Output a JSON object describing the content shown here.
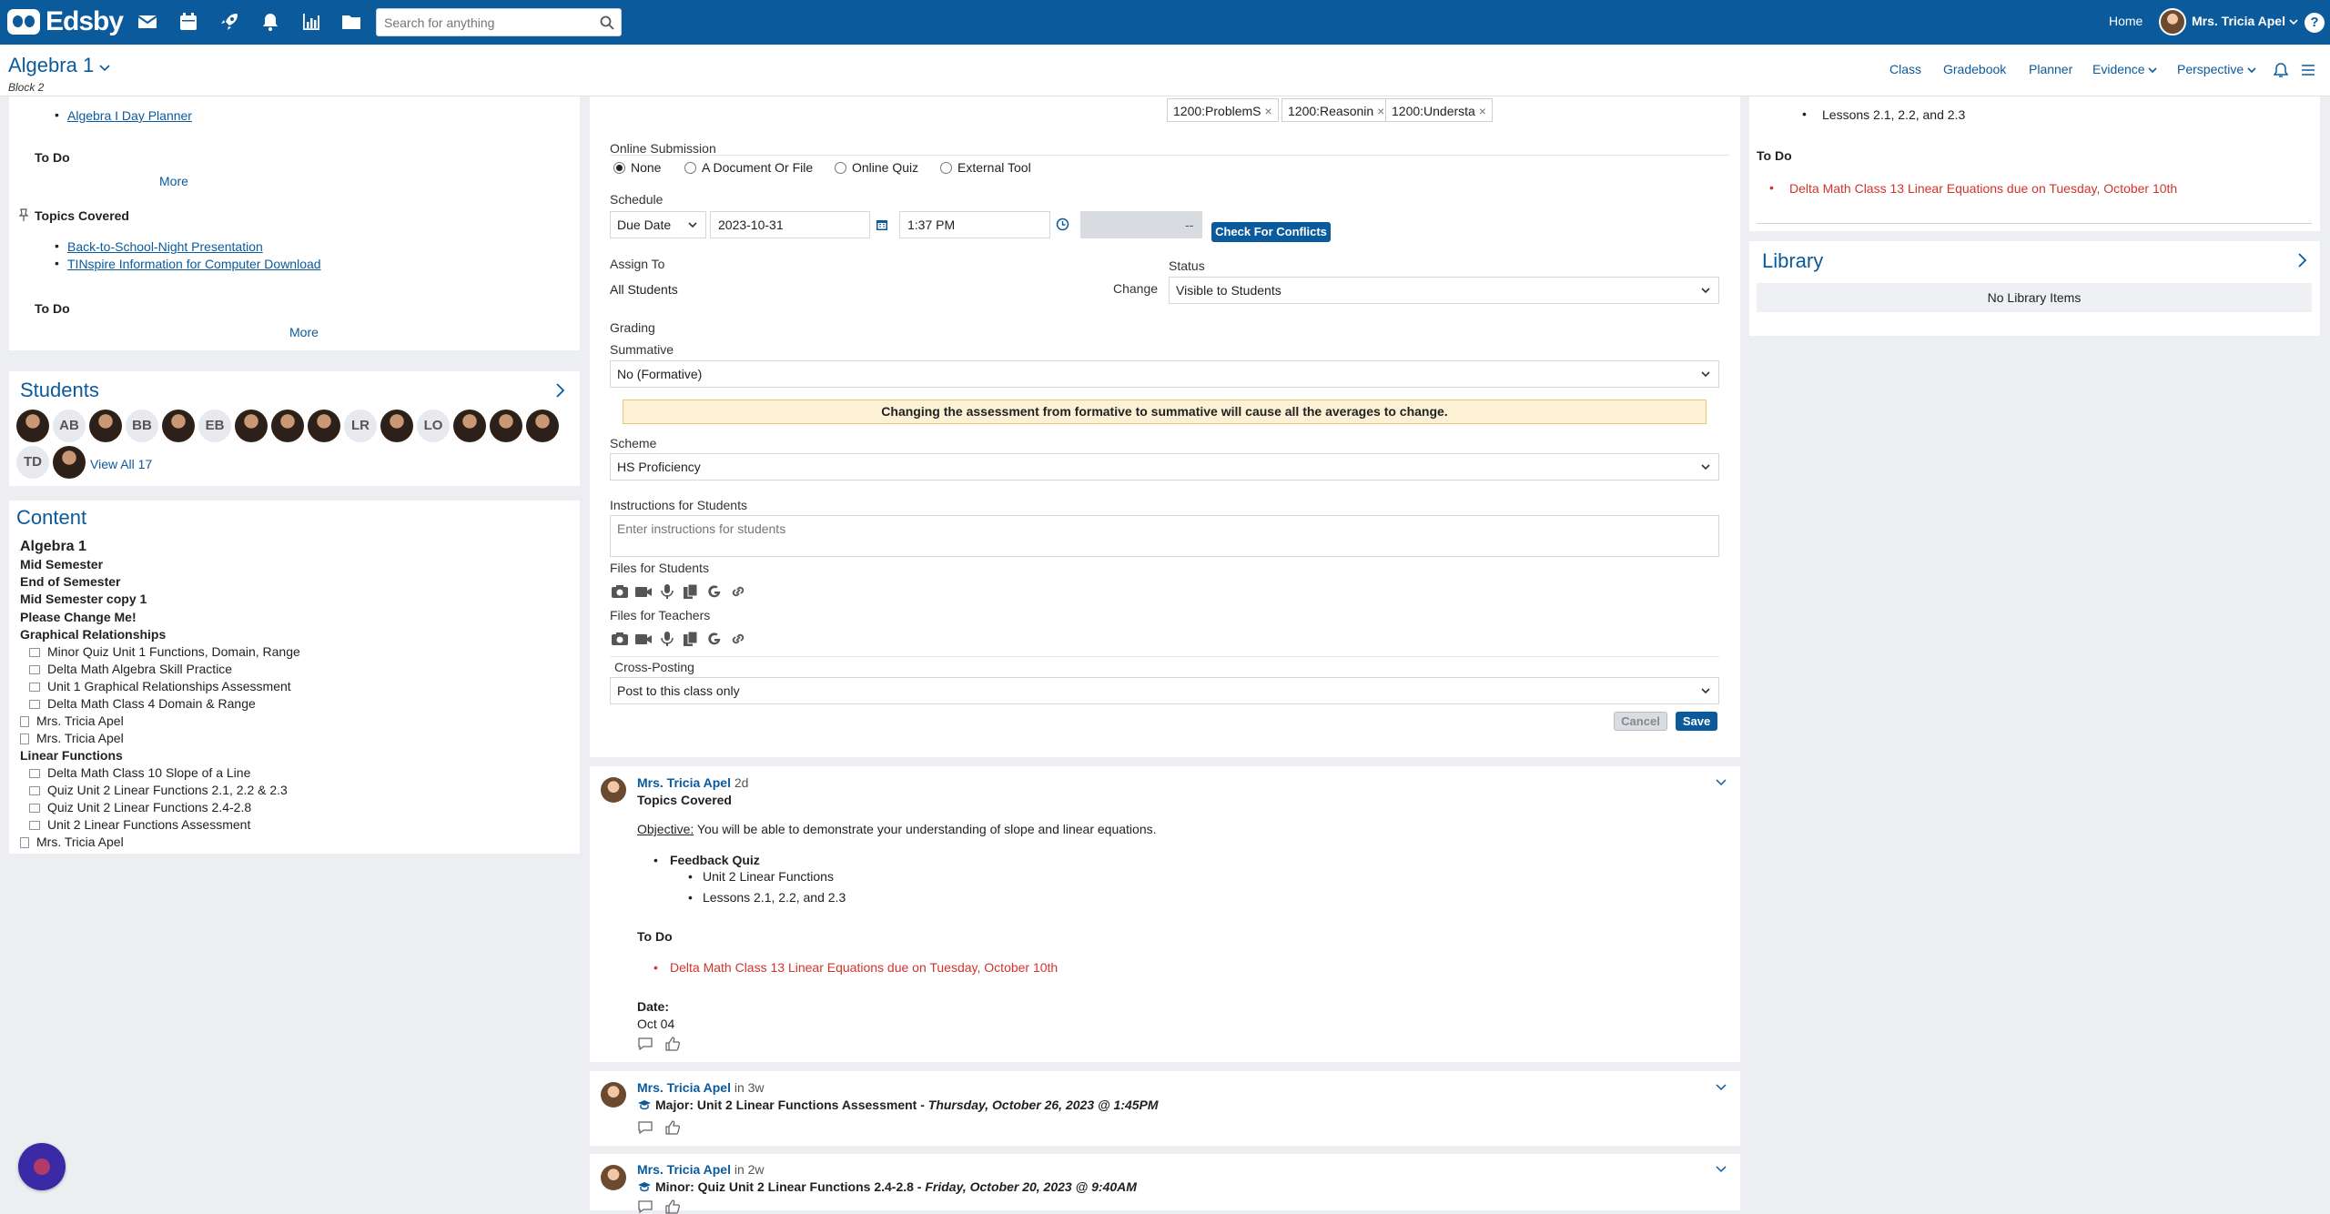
{
  "topbar": {
    "app_name": "Edsby",
    "search_placeholder": "Search for anything",
    "home_label": "Home",
    "user_name": "Mrs. Tricia Apel",
    "help_label": "?"
  },
  "course": {
    "title": "Algebra 1",
    "subtitle": "Block 2",
    "nav": [
      "Class",
      "Gradebook",
      "Planner",
      "Evidence",
      "Perspective"
    ]
  },
  "left": {
    "planner_link": "Algebra I Day Planner",
    "todo_label": "To Do",
    "more_label": "More",
    "topics_title": "Topics Covered",
    "topic_links": [
      "Back-to-School-Night Presentation",
      "TINspire Information for Computer Download"
    ],
    "students_title": "Students",
    "student_initials": [
      "AB",
      "BB",
      "EB",
      "LR",
      "LO",
      "TD"
    ],
    "view_all": "View All 17",
    "content_title": "Content",
    "content_items": [
      "Algebra 1",
      "Mid Semester",
      "End of Semester",
      "Mid Semester copy 1",
      "Please Change Me!",
      "Graphical Relationships",
      "Minor Quiz Unit 1 Functions, Domain, Range",
      "Delta Math Algebra Skill Practice",
      "Unit 1 Graphical Relationships Assessment",
      "Delta Math Class 4 Domain & Range",
      "Mrs. Tricia Apel",
      "Mrs. Tricia Apel",
      "Linear Functions",
      "Delta Math Class 10 Slope of a Line",
      "Quiz Unit 2 Linear Functions 2.1, 2.2 & 2.3",
      "Quiz Unit 2 Linear Functions 2.4-2.8",
      "Unit 2 Linear Functions Assessment",
      "Mrs. Tricia Apel"
    ]
  },
  "form": {
    "tags": [
      "1200:ProblemS",
      "1200:Reasonin",
      "1200:Understa"
    ],
    "online_submission_label": "Online Submission",
    "submission_options": [
      "None",
      "A Document Or File",
      "Online Quiz",
      "External Tool"
    ],
    "schedule_label": "Schedule",
    "schedule_type": "Due Date",
    "date_value": "2023-10-31",
    "time_value": "1:37 PM",
    "end_value": "--",
    "check_conflicts": "Check For Conflicts",
    "assign_to_label": "Assign To",
    "assign_to_value": "All Students",
    "change_label": "Change",
    "status_label": "Status",
    "status_value": "Visible to Students",
    "grading_label": "Grading",
    "summative_label": "Summative",
    "summative_value": "No (Formative)",
    "warning": "Changing the assessment from formative to summative will cause all the averages to change.",
    "scheme_label": "Scheme",
    "scheme_value": "HS Proficiency",
    "instructions_label": "Instructions for Students",
    "instructions_placeholder": "Enter instructions for students",
    "files_students_label": "Files for Students",
    "files_teachers_label": "Files for Teachers",
    "crossposting_label": "Cross-Posting",
    "crossposting_value": "Post to this class only",
    "cancel_label": "Cancel",
    "save_label": "Save"
  },
  "posts": [
    {
      "author": "Mrs. Tricia Apel",
      "meta": "2d",
      "title": "Topics Covered",
      "objective_label": "Objective:",
      "objective_text": "You will be able to demonstrate your understanding of slope and linear equations.",
      "feedback_quiz": "Feedback Quiz",
      "sub_items": [
        "Unit 2 Linear Functions",
        "Lessons 2.1, 2.2, and 2.3"
      ],
      "todo_label": "To Do",
      "todo_item": "Delta Math Class 13 Linear Equations due on Tuesday, October 10th",
      "date_label": "Date:",
      "date_value": "Oct 04"
    },
    {
      "author": "Mrs. Tricia Apel",
      "meta": "in 3w",
      "title_plain": "Major: Unit 2 Linear Functions Assessment - ",
      "title_italic": "Thursday, October 26, 2023 @ 1:45PM"
    },
    {
      "author": "Mrs. Tricia Apel",
      "meta": "in 2w",
      "title_plain": "Minor: Quiz Unit 2 Linear Functions 2.4-2.8  - ",
      "title_italic": "Friday, October 20, 2023 @ 9:40AM"
    }
  ],
  "right": {
    "lesson_item": "Lessons 2.1, 2.2, and 2.3",
    "todo_label": "To Do",
    "todo_item": "Delta Math Class 13 Linear Equations due on Tuesday, October 10th",
    "library_title": "Library",
    "library_empty": "No Library Items"
  }
}
